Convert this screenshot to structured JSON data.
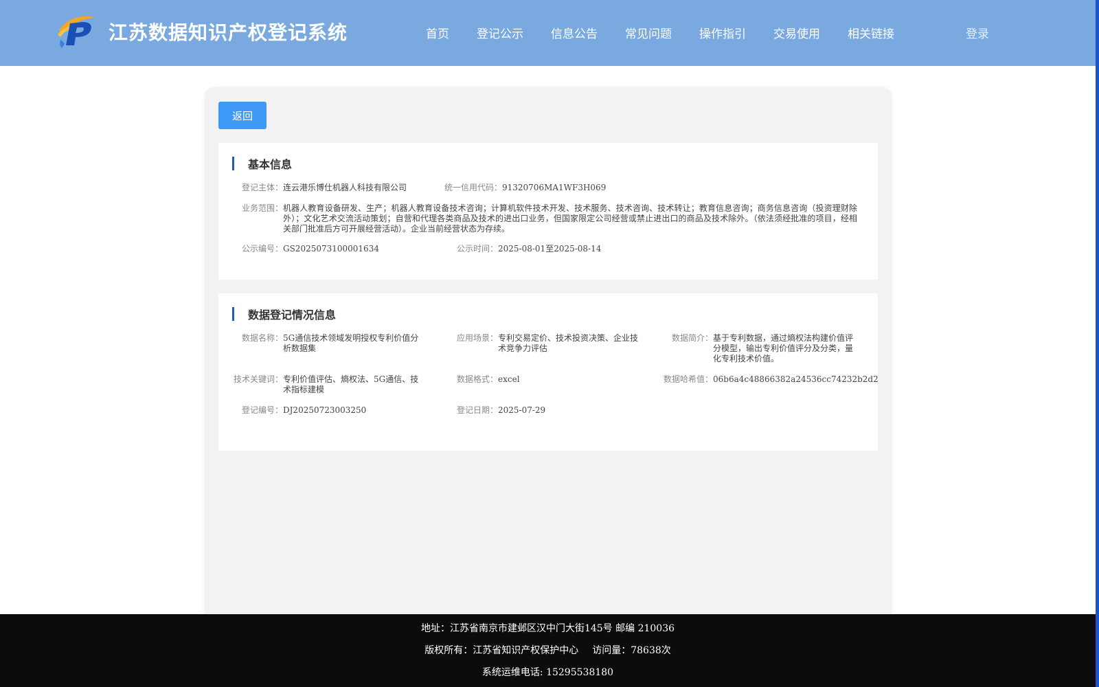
{
  "header": {
    "site_title": "江苏数据知识产权登记系统",
    "logo_icon": "ip-logo-icon",
    "nav": [
      "首页",
      "登记公示",
      "信息公告",
      "常见问题",
      "操作指引",
      "交易使用",
      "相关链接"
    ],
    "login_label": "登录"
  },
  "toolbar": {
    "back_label": "返回"
  },
  "basic_info": {
    "title": "基本信息",
    "subject_label": "登记主体：",
    "subject": "连云港乐博仕机器人科技有限公司",
    "credit_code_label": "统一信用代码：",
    "credit_code": "91320706MA1WF3H069",
    "scope_label": "业务范围：",
    "scope": "机器人教育设备研发、生产；机器人教育设备技术咨询；计算机软件技术开发、技术服务、技术咨询、技术转让；教育信息咨询；商务信息咨询（投资理财除外）；文化艺术交流活动策划；自营和代理各类商品及技术的进出口业务，但国家限定公司经营或禁止进出口的商品及技术除外。（依法须经批准的项目，经相关部门批准后方可开展经营活动）。企业当前经营状态为存续。",
    "notice_no_label": "公示编号：",
    "notice_no": "GS2025073100001634",
    "notice_time_label": "公示时间：",
    "notice_time": "2025-08-01至2025-08-14"
  },
  "data_info": {
    "title": "数据登记情况信息",
    "name_label": "数据名称：",
    "name": "5G通信技术领域发明授权专利价值分析数据集",
    "scenario_label": "应用场景：",
    "scenario": "专利交易定价、技术投资决策、企业技术竞争力评估",
    "intro_label": "数据简介：",
    "intro": "基于专利数据，通过熵权法构建价值评分模型，输出专利价值评分及分类，量化专利技术价值。",
    "keywords_label": "技术关键词：",
    "keywords": "专利价值评估、熵权法、5G通信、技术指标建模",
    "format_label": "数据格式：",
    "format": "excel",
    "hash_label": "数据哈希值：",
    "hash": "06b6a4c48866382a24536cc74232b2d2",
    "reg_no_label": "登记编号：",
    "reg_no": "DJ20250723003250",
    "reg_date_label": "登记日期：",
    "reg_date": "2025-07-29"
  },
  "footer": {
    "address": "地址：江苏省南京市建邺区汉中门大街145号 邮编 210036",
    "copyright": "版权所有：江苏省知识产权保护中心",
    "visits": "访问量：78638次",
    "hotline": "系统运维电话: 15295538180"
  },
  "colors": {
    "header_bg": "#79a9df",
    "accent": "#3d99f5",
    "section_bar": "#1f5fa8",
    "footer_bg": "#0c0c0c"
  }
}
